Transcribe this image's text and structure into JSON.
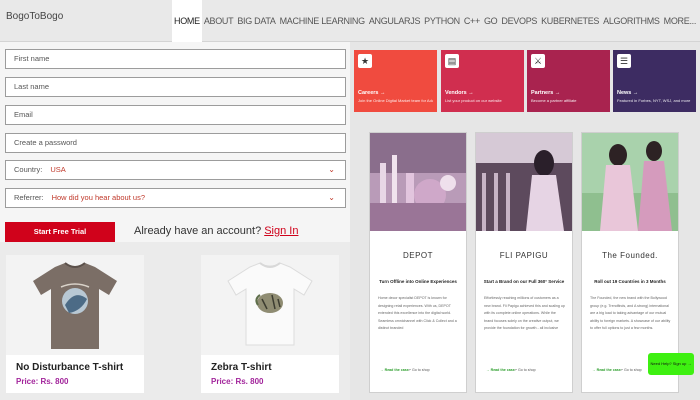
{
  "brand": "BogoToBogo",
  "nav": [
    "HOME",
    "ABOUT",
    "BIG DATA",
    "MACHINE LEARNING",
    "ANGULARJS",
    "PYTHON",
    "C++",
    "GO",
    "DEVOPS",
    "KUBERNETES",
    "ALGORITHMS",
    "MORE..."
  ],
  "form": {
    "first_name_placeholder": "First name",
    "last_name_placeholder": "Last name",
    "email_placeholder": "Email",
    "password_placeholder": "Create a password",
    "country_label": "Country:",
    "country_value": "USA",
    "referrer_label": "Referrer:",
    "referrer_value": "How did you hear about us?",
    "cta": "Start Free Trial",
    "login_prompt": "Already have an account?",
    "login_link": "Sign In"
  },
  "products": [
    {
      "name": "No Disturbance T-shirt",
      "price": "Price: Rs. 800"
    },
    {
      "name": "Zebra T-shirt",
      "price": "Price: Rs. 800"
    }
  ],
  "tiles": [
    {
      "title": "Careers →",
      "desc": "Join the Online Digital Market team for Adults",
      "color": "#f04b3f",
      "icon": "briefcase-icon",
      "glyph": "★"
    },
    {
      "title": "Vendors →",
      "desc": "List your product on our website",
      "color": "#d02e4f",
      "icon": "vendor-icon",
      "glyph": "▤"
    },
    {
      "title": "Partners →",
      "desc": "Become a partner affiliate",
      "color": "#a9234f",
      "icon": "handshake-icon",
      "glyph": "⚔"
    },
    {
      "title": "News →",
      "desc": "Featured in Forbes, NYT, WSJ, and more",
      "color": "#3d2c62",
      "icon": "news-icon",
      "glyph": "☰"
    }
  ],
  "cards": [
    {
      "brand": "DEPOT",
      "heading": "Turn Offline into Online Experiences",
      "body": "Home decor specialist DEPOT is known for designing retail experiences. With us, DEPOT extended this excellence into the digital world. Seamless omnichannel with Click & Collect and a distinct branded",
      "read_more": "→ Read the case",
      "goto": "↗ Go to shop"
    },
    {
      "brand": "FLI PAPIGU",
      "heading": "Start a Brand on our Full 360° Service",
      "body": "Effortlessly reaching millions of customers as a new brand. Fli Papigu achieved this and scaling up with its complete online operations. While the brand focuses solely on the creative output, we provide the foundation for growth - all inclusive",
      "read_more": "→ Read the case",
      "goto": "↗ Go to shop"
    },
    {
      "brand": "The Founded.",
      "heading": "Roll out 19 Countries in 3 Months",
      "body": "The Founded, the new brand with the Bollywood group (e.g. Trendfinds, and A strong) international are a big load to taking advantage of our mutual ability to foreign markets. A showcase of our ability to offer full options to just a few months.",
      "read_more": "→ Read the case",
      "goto": "↗ Go to shop"
    }
  ],
  "chip": "Need Help? Sign up →"
}
